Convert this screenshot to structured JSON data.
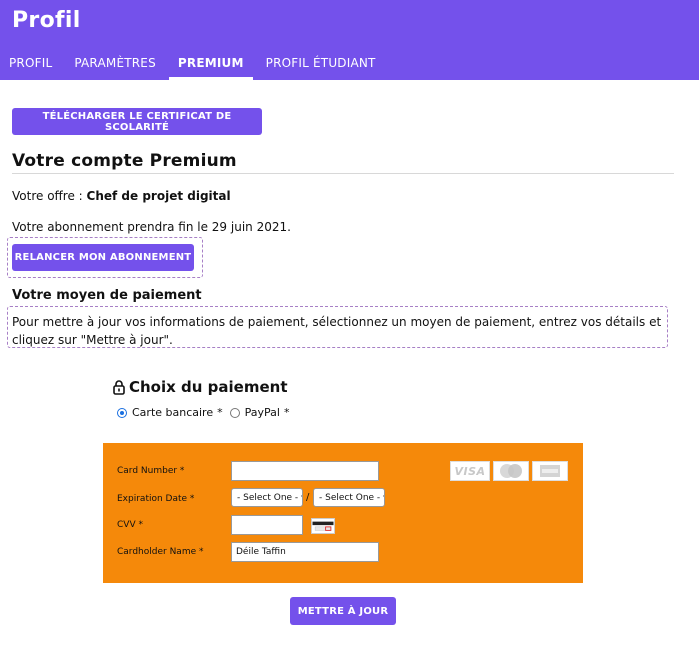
{
  "header": {
    "title": "Profil",
    "tabs": [
      {
        "label": "PROFIL",
        "active": false
      },
      {
        "label": "PARAMÈTRES",
        "active": false
      },
      {
        "label": "PREMIUM",
        "active": true
      },
      {
        "label": "PROFIL ÉTUDIANT",
        "active": false
      }
    ]
  },
  "certificate_button": "TÉLÉCHARGER LE CERTIFICAT DE SCOLARITÉ",
  "premium": {
    "title": "Votre compte Premium",
    "offer_label": "Votre offre :",
    "offer_value": "Chef de projet digital",
    "subscription_end": "Votre abonnement prendra fin le 29 juin 2021.",
    "renew_button": "RELANCER MON ABONNEMENT"
  },
  "payment": {
    "title": "Votre moyen de paiement",
    "description": "Pour mettre à jour vos informations de paiement, sélectionnez un moyen de paiement, entrez vos détails et cliquez sur \"Mettre à jour\".",
    "choice_title": "Choix du paiement",
    "options": [
      {
        "label": "Carte bancaire",
        "checked": true
      },
      {
        "label": "PayPal",
        "checked": false
      }
    ],
    "required_mark": "*"
  },
  "card_form": {
    "card_number_label": "Card Number *",
    "card_number_value": "",
    "expiration_label": "Expiration Date *",
    "month_select": "- Select One -",
    "year_select": "- Select One -",
    "separator": "/",
    "cvv_label": "CVV *",
    "cvv_value": "",
    "holder_label": "Cardholder Name *",
    "holder_value": "Déile Taffin",
    "card_logos": [
      "visa-icon",
      "mastercard-icon",
      "amex-icon"
    ],
    "visa_text": "VISA"
  },
  "submit_button": "METTRE À JOUR",
  "colors": {
    "brand": "#7451eb",
    "card_panel": "#f5890a",
    "dashed": "#a77fc6"
  }
}
